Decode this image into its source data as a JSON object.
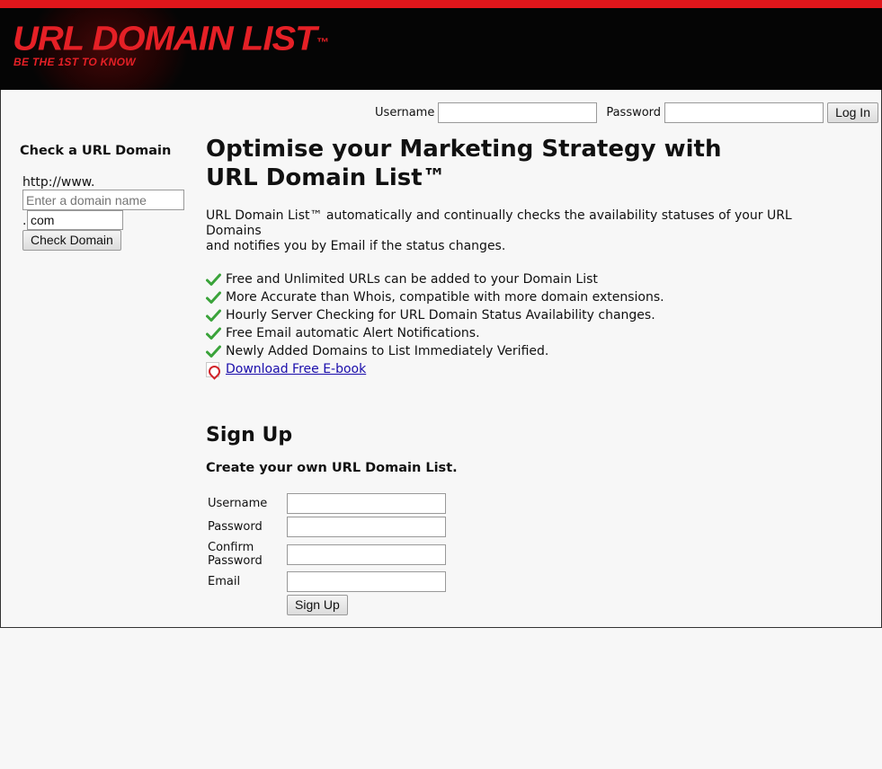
{
  "brand": {
    "title": "URL DOMAIN LIST",
    "trademark": "™",
    "tagline": "BE THE 1ST TO KNOW",
    "colors": {
      "accent": "#e52026",
      "banner": "#050505"
    }
  },
  "login": {
    "username_label": "Username",
    "password_label": "Password",
    "button": "Log In"
  },
  "sidebar": {
    "heading": "Check a URL Domain",
    "prefix": "http://www.",
    "domain_placeholder": "Enter a domain name",
    "dot": ".",
    "extension_value": "com",
    "button": "Check Domain"
  },
  "main": {
    "heading_line1": "Optimise your Marketing Strategy with",
    "heading_line2": "URL Domain List™",
    "intro_line1": "URL Domain List™ automatically and continually checks the availability statuses of your URL Domains",
    "intro_line2": "and notifies you by Email if the status changes.",
    "features": [
      "Free and Unlimited URLs can be added to your Domain List",
      "More Accurate than Whois, compatible with more domain extensions.",
      "Hourly Server Checking for URL Domain Status Availability changes.",
      "Free Email automatic Alert Notifications.",
      "Newly Added Domains to List Immediately Verified."
    ],
    "ebook_link": "Download Free E-book"
  },
  "signup": {
    "heading": "Sign Up",
    "subheading": "Create your own URL Domain List.",
    "username_label": "Username",
    "password_label": "Password",
    "confirm_label_1": "Confirm",
    "confirm_label_2": "Password",
    "email_label": "Email",
    "button": "Sign Up"
  }
}
